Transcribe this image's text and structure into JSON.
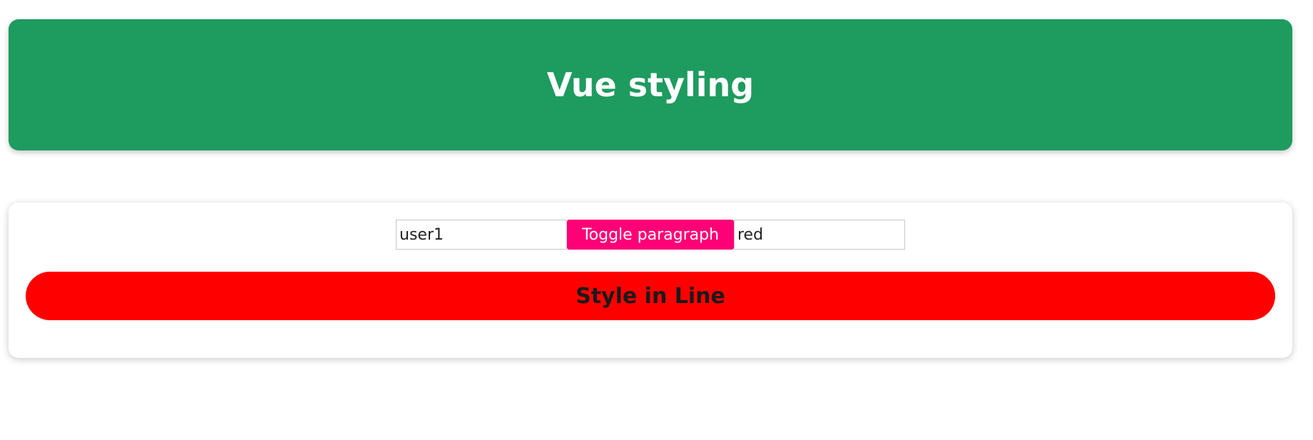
{
  "header": {
    "title": "Vue styling"
  },
  "controls": {
    "user_input_value": "user1",
    "toggle_button_label": "Toggle paragraph",
    "color_input_value": "red"
  },
  "paragraph": {
    "text": "Style in Line",
    "background_color": "#ff0000"
  },
  "colors": {
    "header_bg": "#1e9b5f",
    "button_bg": "#ff0077"
  }
}
